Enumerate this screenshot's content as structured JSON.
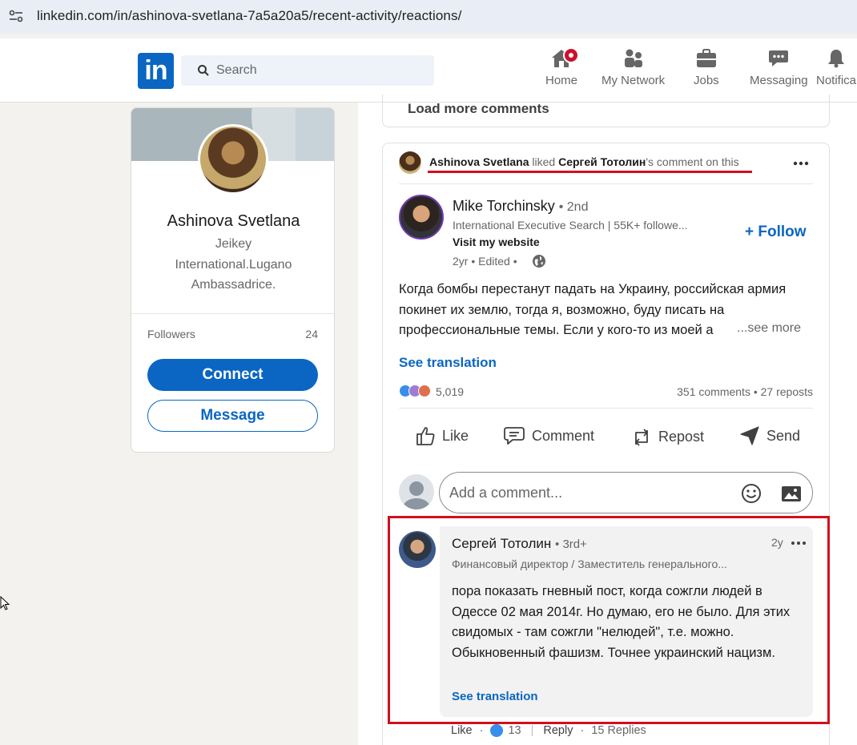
{
  "browser": {
    "url": "linkedin.com/in/ashinova-svetlana-7a5a20a5/recent-activity/reactions/"
  },
  "nav": {
    "logo": "in",
    "search_placeholder": "Search",
    "items": [
      {
        "label": "Home",
        "icon": "home-icon"
      },
      {
        "label": "My Network",
        "icon": "network-icon"
      },
      {
        "label": "Jobs",
        "icon": "briefcase-icon"
      },
      {
        "label": "Messaging",
        "icon": "message-icon"
      },
      {
        "label": "Notifica",
        "icon": "bell-icon"
      }
    ]
  },
  "profile": {
    "name": "Ashinova Svetlana",
    "headline": "Jeikey International.Lugano Ambassadrice.",
    "followers_label": "Followers",
    "followers_count": "24",
    "connect_label": "Connect",
    "message_label": "Message"
  },
  "feed": {
    "load_more": "Load more comments",
    "activity": {
      "actor": "Ashinova Svetlana",
      "verb": "liked",
      "target": "Сергей Тотолин",
      "suffix": "'s comment on this"
    },
    "post": {
      "author": "Mike Torchinsky",
      "degree": "• 2nd",
      "headline": "International Executive Search | 55K+ followe...",
      "website": "Visit my website",
      "meta": "2yr • Edited •",
      "follow_label": "+ Follow",
      "text": "Когда бомбы перестанут падать на Украину, российская армия покинет их землю, тогда я, возможно, буду писать на профессиональные темы. Если у кого-то из моей а",
      "see_more": "...see more",
      "see_translation": "See translation",
      "reaction_count": "5,019",
      "comments_reposts": "351 comments • 27 reposts",
      "actions": [
        "Like",
        "Comment",
        "Repost",
        "Send"
      ]
    },
    "comment_input": {
      "placeholder": "Add a comment..."
    },
    "comment": {
      "author": "Сергей Тотолин",
      "degree": "• 3rd+",
      "headline": "Финансовый директор / Заместитель генерального...",
      "time": "2y",
      "text": "пора показать гневный пост, когда сожгли людей в Одессе 02 мая 2014г. Но думаю, его не было. Для этих свидомых - там сожгли \"нелюдей\", т.е. можно. Обыкновенный фашизм. Точнее украинский нацизм.",
      "see_translation": "See translation",
      "like_label": "Like",
      "like_count": "13",
      "reply_label": "Reply",
      "replies": "15 Replies"
    }
  },
  "colors": {
    "brand": "#0a66c2",
    "highlight_red": "#d1101e",
    "notification_badge": "#cb112d"
  }
}
